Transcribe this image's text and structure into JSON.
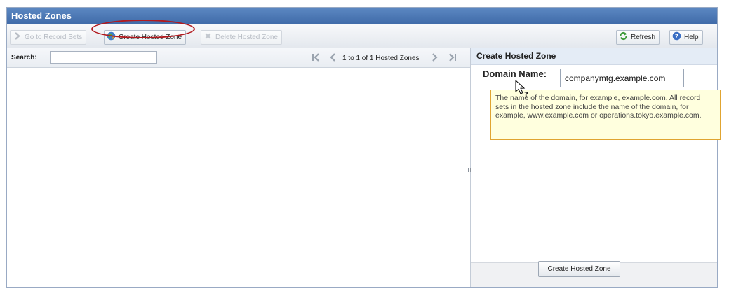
{
  "panel": {
    "title": "Hosted Zones"
  },
  "toolbar": {
    "go_to_record_sets": "Go to Record Sets",
    "create_hosted_zone": "Create Hosted Zone",
    "delete_hosted_zone": "Delete Hosted Zone",
    "refresh": "Refresh",
    "help": "Help"
  },
  "list": {
    "search_label": "Search:",
    "search_value": "",
    "pagination": "1 to 1 of 1 Hosted Zones"
  },
  "form": {
    "title": "Create Hosted Zone",
    "domain_name_label": "Domain Name:",
    "domain_name_value": "companymtg.example.com",
    "tooltip": "The name of the domain, for example, example.com. All record sets in the hosted zone include the name of the domain, for example, www.example.com or operations.tokyo.example.com.",
    "submit_label": "Create Hosted Zone"
  },
  "icons": {
    "go_to_record_sets": "chevron-right-icon",
    "create_hosted_zone": "globe-icon",
    "delete_hosted_zone": "delete-icon",
    "refresh": "refresh-icon",
    "help": "help-icon",
    "first_page": "first-page-icon",
    "prev_page": "prev-page-icon",
    "next_page": "next-page-icon",
    "last_page": "last-page-icon"
  },
  "colors": {
    "title_bar": "#4a76b3",
    "highlight_circle": "#b2191e",
    "tooltip_background": "#ffffde",
    "tooltip_border": "#e0a431"
  }
}
